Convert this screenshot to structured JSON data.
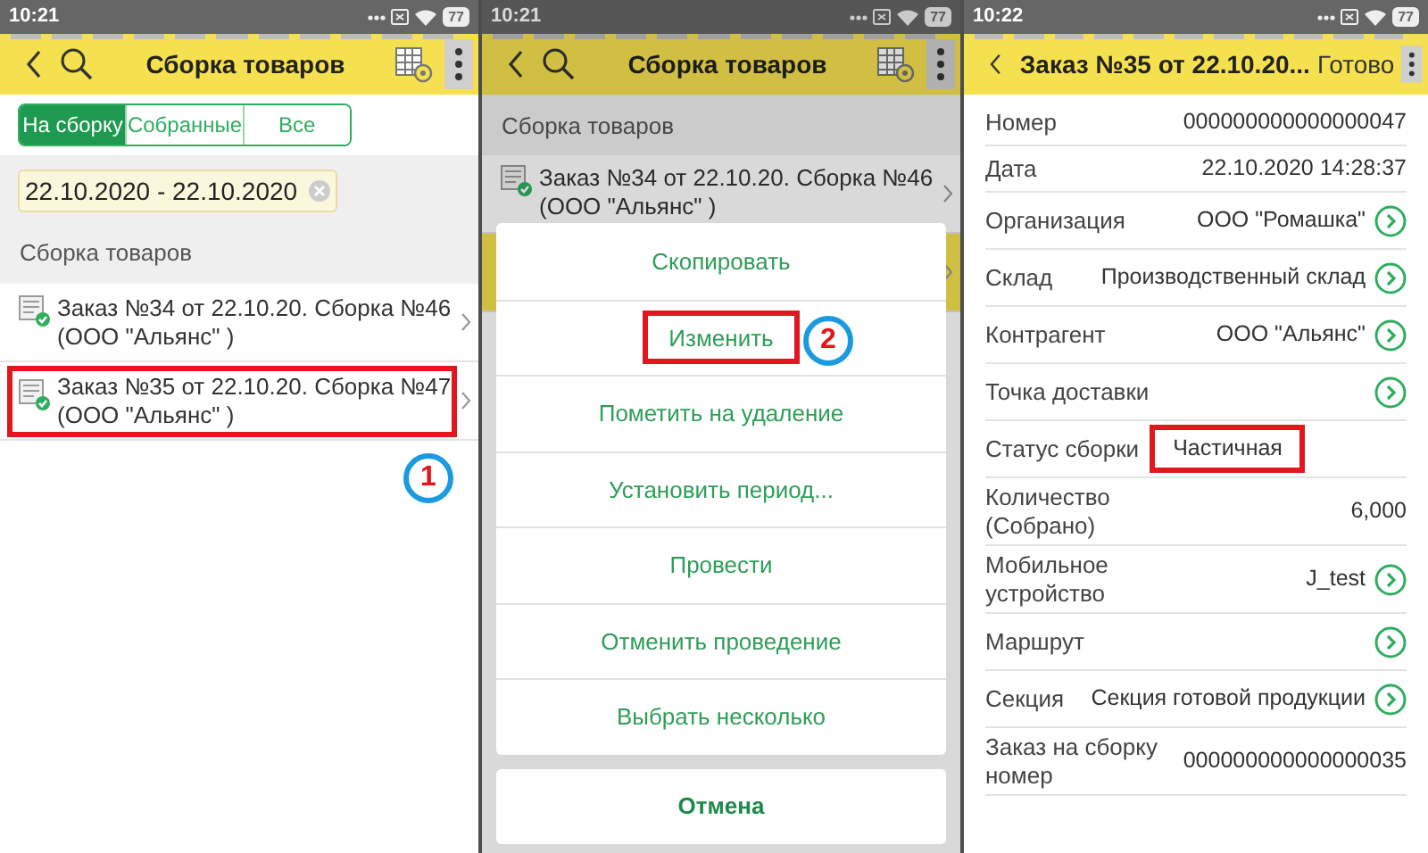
{
  "panels": [
    {
      "status_bar": {
        "time": "10:21",
        "battery": "77"
      },
      "header": {
        "title": "Сборка товаров"
      },
      "segments": [
        {
          "label": "На сборку",
          "selected": true
        },
        {
          "label": "Собранные",
          "selected": false
        },
        {
          "label": "Все",
          "selected": false
        }
      ],
      "period": {
        "value": "22.10.2020 - 22.10.2020"
      },
      "section": "Сборка товаров",
      "list": [
        {
          "title": "Заказ №34 от 22.10.20. Сборка №46 (ООО \"Альянс\" )",
          "selected": false,
          "highlighted": false
        },
        {
          "title": "Заказ №35 от 22.10.20. Сборка №47 (ООО \"Альянс\" )",
          "selected": false,
          "highlighted": true
        }
      ],
      "annotation": "1"
    },
    {
      "status_bar": {
        "time": "10:21",
        "battery": "77"
      },
      "header": {
        "title": "Сборка товаров"
      },
      "section": "Сборка товаров",
      "list": [
        {
          "title": "Заказ №34 от 22.10.20. Сборка №46 (ООО \"Альянс\" )",
          "selected": false,
          "highlighted": false
        },
        {
          "selected": true,
          "highlighted": false
        }
      ],
      "menu": [
        {
          "label": "Скопировать",
          "highlighted": false
        },
        {
          "label": "Изменить",
          "highlighted": true,
          "annotation": "2"
        },
        {
          "label": "Пометить на удаление",
          "highlighted": false
        },
        {
          "label": "Установить период...",
          "highlighted": false
        },
        {
          "label": "Провести",
          "highlighted": false
        },
        {
          "label": "Отменить проведение",
          "highlighted": false
        },
        {
          "label": "Выбрать несколько",
          "highlighted": false
        }
      ],
      "cancel": "Отмена"
    },
    {
      "status_bar": {
        "time": "10:22",
        "battery": "77"
      },
      "header": {
        "title": "Заказ №35 от 22.10.20...",
        "done": "Готово"
      },
      "fields": [
        {
          "label": "Номер",
          "value": "000000000000000047",
          "link": false,
          "highlighted": false
        },
        {
          "label": "Дата",
          "value": "22.10.2020 14:28:37",
          "link": false,
          "highlighted": false
        },
        {
          "label": "Организация",
          "value": "ООО \"Ромашка\"",
          "link": true,
          "highlighted": false
        },
        {
          "label": "Склад",
          "value": "Производственный склад",
          "link": true,
          "highlighted": false
        },
        {
          "label": "Контрагент",
          "value": "ООО \"Альянс\"",
          "link": true,
          "highlighted": false
        },
        {
          "label": "Точка доставки",
          "link": true,
          "highlighted": false
        },
        {
          "label": "Статус сборки",
          "value": "Частичная",
          "link": false,
          "highlighted": true
        },
        {
          "label": "Количество (Собрано)",
          "value": "6,000",
          "link": false,
          "highlighted": false
        },
        {
          "label": "Мобильное устройство",
          "value": "J_test",
          "link": true,
          "highlighted": false
        },
        {
          "label": "Маршрут",
          "link": true,
          "highlighted": false
        },
        {
          "label": "Секция",
          "value": "Секция готовой продукции",
          "link": true,
          "highlighted": false
        },
        {
          "label": "Заказ на сборку номер",
          "value": "000000000000000035",
          "link": false,
          "highlighted": false
        }
      ]
    }
  ]
}
